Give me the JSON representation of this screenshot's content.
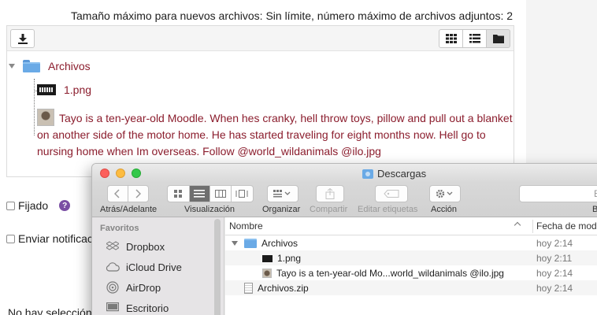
{
  "form": {
    "max_info": "Tamaño máximo para nuevos archivos: Sin límite, número máximo de archivos adjuntos: 2",
    "tree": {
      "root_label": "Archivos",
      "file1": "1.png",
      "file2": "Tayo is a ten-year-old Moodle. When hes cranky, hell throw toys, pillow and pull out a blanket on another side of the motor home. He has started traveling for eight months now. Hell go to nursing home when Im overseas. Follow @world_wildanimals @ilo.jpg"
    },
    "fijado_label": "Fijado",
    "help_glyph": "?",
    "enviar_label": "Enviar notificac",
    "noselect": "No hay selección"
  },
  "finder": {
    "title": "Descargas",
    "toolbar": {
      "back_fwd_label": "Atrás/Adelante",
      "view_label": "Visualización",
      "arrange_label": "Organizar",
      "share_label": "Compartir",
      "tags_label": "Editar etiquetas",
      "action_label": "Acción",
      "search_partial": "B",
      "search_label_partial": "B"
    },
    "sidebar": {
      "header": "Favoritos",
      "items": [
        {
          "label": "Dropbox",
          "icon": "dropbox-icon"
        },
        {
          "label": "iCloud Drive",
          "icon": "cloud-icon"
        },
        {
          "label": "AirDrop",
          "icon": "airdrop-icon"
        },
        {
          "label": "Escritorio",
          "icon": "desktop-icon"
        }
      ]
    },
    "list": {
      "col_name": "Nombre",
      "col_date": "Fecha de modi",
      "rows": [
        {
          "name": "Archivos",
          "date": "hoy 2:14"
        },
        {
          "name": "1.png",
          "date": "hoy 2:11"
        },
        {
          "name": "Tayo is a ten-year-old Mo...world_wildanimals @ilo.jpg",
          "date": "hoy 2:14"
        },
        {
          "name": "Archivos.zip",
          "date": "hoy 2:14"
        }
      ]
    }
  }
}
